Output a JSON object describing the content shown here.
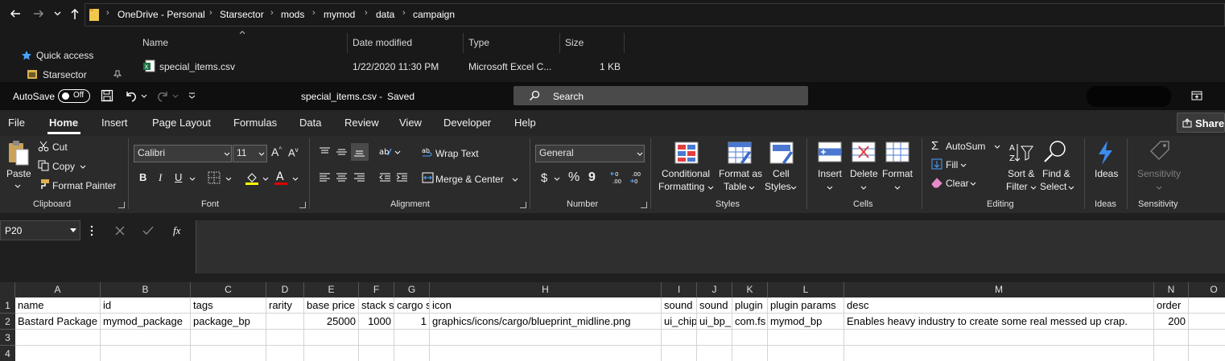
{
  "explorer": {
    "breadcrumb": [
      "OneDrive - Personal",
      "Starsector",
      "mods",
      "mymod",
      "data",
      "campaign"
    ],
    "columns": {
      "name": "Name",
      "date": "Date modified",
      "type": "Type",
      "size": "Size"
    },
    "file": {
      "name": "special_items.csv",
      "date": "1/22/2020 11:30 PM",
      "type": "Microsoft Excel C...",
      "size": "1 KB"
    },
    "nav": {
      "quick_access": "Quick access",
      "starsector": "Starsector"
    }
  },
  "excel": {
    "autosave_label": "AutoSave",
    "autosave_state": "Off",
    "doc_title": "special_items.csv",
    "doc_status": "Saved",
    "search_placeholder": "Search",
    "tabs": [
      "File",
      "Home",
      "Insert",
      "Page Layout",
      "Formulas",
      "Data",
      "Review",
      "View",
      "Developer",
      "Help"
    ],
    "active_tab": "Home",
    "share_label": "Share"
  },
  "ribbon": {
    "clipboard": {
      "paste": "Paste",
      "cut": "Cut",
      "copy": "Copy",
      "format_painter": "Format Painter",
      "label": "Clipboard"
    },
    "font": {
      "font_name": "Calibri",
      "font_size": "11",
      "bold": "B",
      "italic": "I",
      "underline": "U",
      "label": "Font"
    },
    "alignment": {
      "wrap_text": "Wrap Text",
      "merge_center": "Merge & Center",
      "label": "Alignment"
    },
    "number": {
      "format": "General",
      "currency": "$",
      "percent": "%",
      "comma": "9",
      "label": "Number"
    },
    "styles": {
      "conditional": "Conditional",
      "formatting": "Formatting",
      "format_as": "Format as",
      "table": "Table",
      "cell": "Cell",
      "styles_btn": "Styles",
      "label": "Styles"
    },
    "cells": {
      "insert": "Insert",
      "delete": "Delete",
      "format": "Format",
      "label": "Cells"
    },
    "editing": {
      "autosum": "AutoSum",
      "fill": "Fill",
      "clear": "Clear",
      "sort_filter_1": "Sort &",
      "sort_filter_2": "Filter",
      "find_select_1": "Find &",
      "find_select_2": "Select",
      "label": "Editing"
    },
    "ideas": {
      "ideas": "Ideas",
      "label": "Ideas"
    },
    "sensitivity": {
      "sensitivity": "Sensitivity",
      "label": "Sensitivity"
    }
  },
  "formula_bar": {
    "name_box": "P20",
    "fx": "fx",
    "value": ""
  },
  "sheet": {
    "columns": [
      "A",
      "B",
      "C",
      "D",
      "E",
      "F",
      "G",
      "H",
      "I",
      "J",
      "K",
      "L",
      "M",
      "N",
      "O"
    ],
    "rows": [
      "1",
      "2",
      "3",
      "4"
    ],
    "row1": [
      "name",
      "id",
      "tags",
      "rarity",
      "base price",
      "stack s",
      "cargo s",
      "icon",
      "sound",
      "sound",
      "plugin",
      "plugin params",
      "desc",
      "order",
      ""
    ],
    "row2": [
      "Bastard Package",
      "mymod_package",
      "package_bp",
      "",
      "25000",
      "1000",
      "1",
      "graphics/icons/cargo/blueprint_midline.png",
      "ui_chip",
      "ui_bp_",
      "com.fs",
      "mymod_bp",
      "Enables heavy industry to create some real messed up crap.",
      "200",
      ""
    ]
  }
}
